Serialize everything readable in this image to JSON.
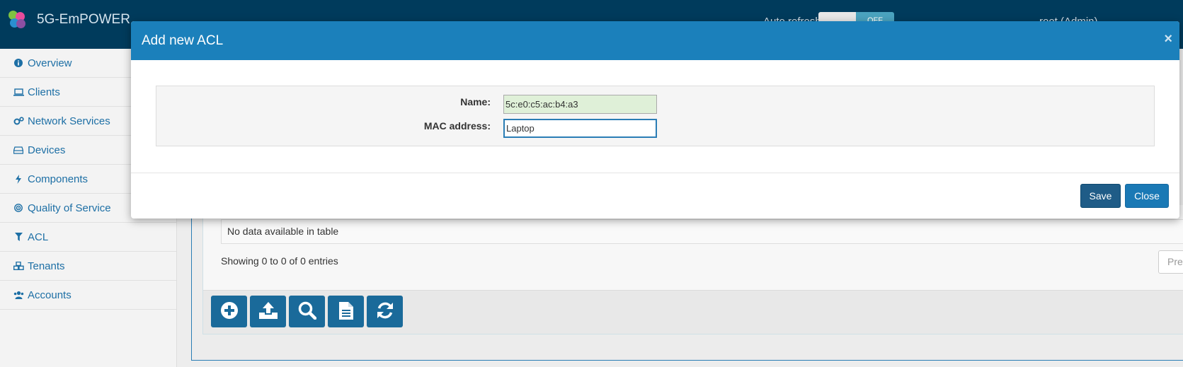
{
  "navbar": {
    "brand": "5G-EmPOWER",
    "auto_refresh_label": "Auto refresh",
    "auto_refresh_state": "OFF",
    "user": "root (Admin)",
    "logo_colors": [
      "#e84c9b",
      "#7fc241",
      "#2a8fd0",
      "#8b4fa3"
    ]
  },
  "sidebar": {
    "items": [
      {
        "label": "Overview",
        "icon": "info-icon"
      },
      {
        "label": "Clients",
        "icon": "laptop-icon"
      },
      {
        "label": "Network Services",
        "icon": "cogs-icon"
      },
      {
        "label": "Devices",
        "icon": "hdd-icon"
      },
      {
        "label": "Components",
        "icon": "bolt-icon"
      },
      {
        "label": "Quality of Service",
        "icon": "bullseye-icon"
      },
      {
        "label": "ACL",
        "icon": "filter-icon"
      },
      {
        "label": "Tenants",
        "icon": "cubes-icon"
      },
      {
        "label": "Accounts",
        "icon": "users-icon"
      }
    ]
  },
  "table": {
    "empty_message": "No data available in table",
    "showing": "Showing 0 to 0 of 0 entries",
    "prev_label": "Pre"
  },
  "toolbar": {
    "buttons": [
      "add-icon",
      "upload-icon",
      "search-icon",
      "document-icon",
      "refresh-icon"
    ]
  },
  "modal": {
    "title": "Add new ACL",
    "close_glyph": "×",
    "name_label": "Name:",
    "name_value": "5c:e0:c5:ac:b4:a3",
    "mac_label": "MAC address:",
    "mac_value": "Laptop",
    "save_label": "Save",
    "close_label": "Close"
  },
  "colors": {
    "navbar": "#003b5c",
    "modal_header": "#1b80bb",
    "primary_button": "#1a79b5",
    "link": "#1d6fa5"
  }
}
